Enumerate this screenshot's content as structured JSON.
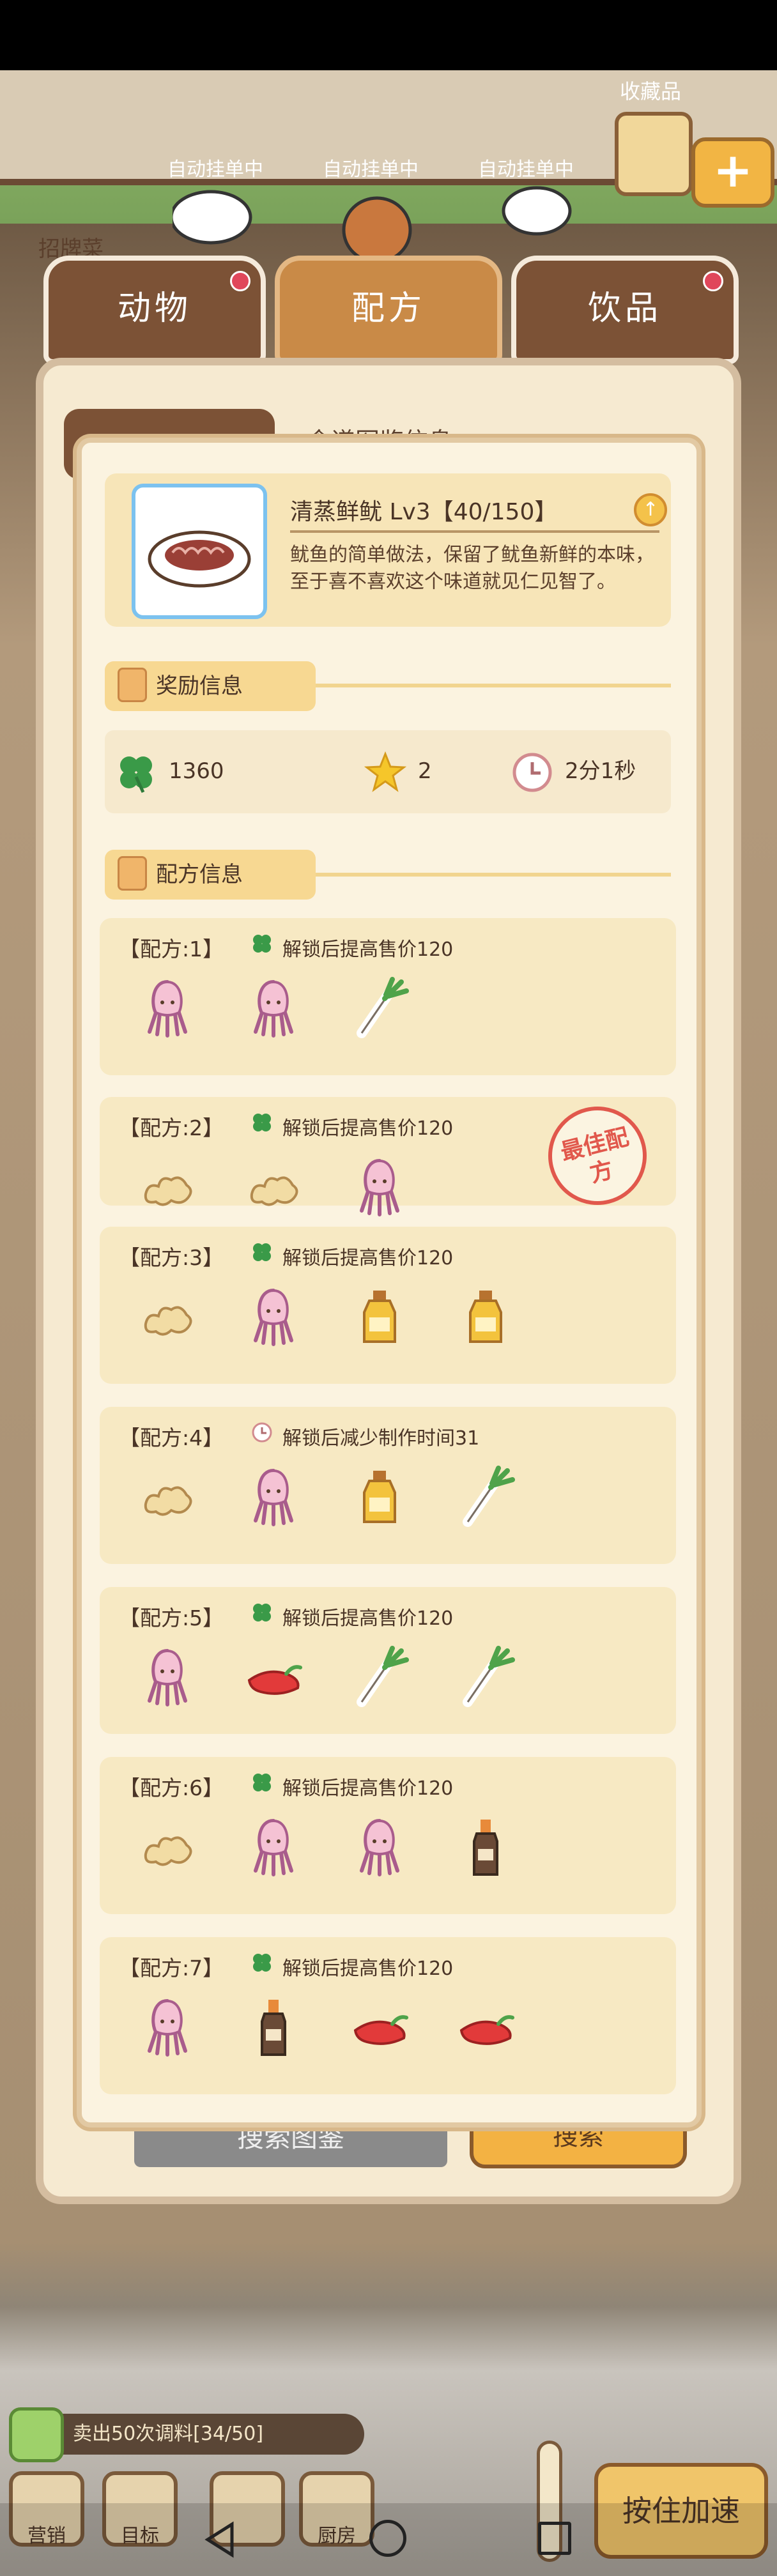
{
  "background": {
    "auto_sign": [
      "自动挂单中",
      "自动挂单中",
      "自动挂单中"
    ],
    "collection_label": "收藏品",
    "signboard_label": "招牌菜"
  },
  "tabs": [
    {
      "label": "动物",
      "active": false,
      "badge": true
    },
    {
      "label": "配方",
      "active": true,
      "badge": false
    },
    {
      "label": "饮品",
      "active": false,
      "badge": true
    }
  ],
  "outer_panel": {
    "hint": "食谱图鉴信息",
    "search_button": "搜索图鉴",
    "confirm_button": "搜索"
  },
  "dish": {
    "name": "清蒸鲜鱿 Lv3【40/150】",
    "description": "鱿鱼的简单做法，保留了鱿鱼新鲜的本味，至于喜不喜欢这个味道就见仁见智了。",
    "info_icon": "up-arrow-icon"
  },
  "reward_section": {
    "title": "奖励信息",
    "clover_value": "1360",
    "star_value": "2",
    "time_value": "2分1秒"
  },
  "recipe_section": {
    "title": "配方信息",
    "best_stamp": "最佳配方",
    "recipes": [
      {
        "title": "【配方:1】",
        "note": "解锁后提高售价120",
        "note_icon": "clover",
        "ingredients": [
          "squid",
          "squid",
          "scallion"
        ]
      },
      {
        "title": "【配方:2】",
        "note": "解锁后提高售价120",
        "note_icon": "clover",
        "ingredients": [
          "ginger",
          "ginger",
          "squid"
        ]
      },
      {
        "title": "【配方:3】",
        "note": "解锁后提高售价120",
        "note_icon": "clover",
        "ingredients": [
          "ginger",
          "squid",
          "oil",
          "oil"
        ]
      },
      {
        "title": "【配方:4】",
        "note": "解锁后减少制作时间31",
        "note_icon": "clock",
        "ingredients": [
          "ginger",
          "squid",
          "oil",
          "scallion"
        ]
      },
      {
        "title": "【配方:5】",
        "note": "解锁后提高售价120",
        "note_icon": "clover",
        "ingredients": [
          "squid",
          "chili",
          "scallion",
          "scallion"
        ]
      },
      {
        "title": "【配方:6】",
        "note": "解锁后提高售价120",
        "note_icon": "clover",
        "ingredients": [
          "ginger",
          "squid",
          "squid",
          "soy-sauce"
        ]
      },
      {
        "title": "【配方:7】",
        "note": "解锁后提高售价120",
        "note_icon": "clover",
        "ingredients": [
          "squid",
          "soy-sauce",
          "chili",
          "chili"
        ]
      }
    ]
  },
  "bottom": {
    "goal_text": "卖出50次调料[34/50]",
    "buttons": [
      "营销",
      "目标",
      "",
      "厨房"
    ],
    "hold_button": "按住加速"
  },
  "colors": {
    "accent": "#f3b243",
    "panel": "#f6ead1",
    "clover": "#3a9a48",
    "stamp": "#e1584c"
  }
}
